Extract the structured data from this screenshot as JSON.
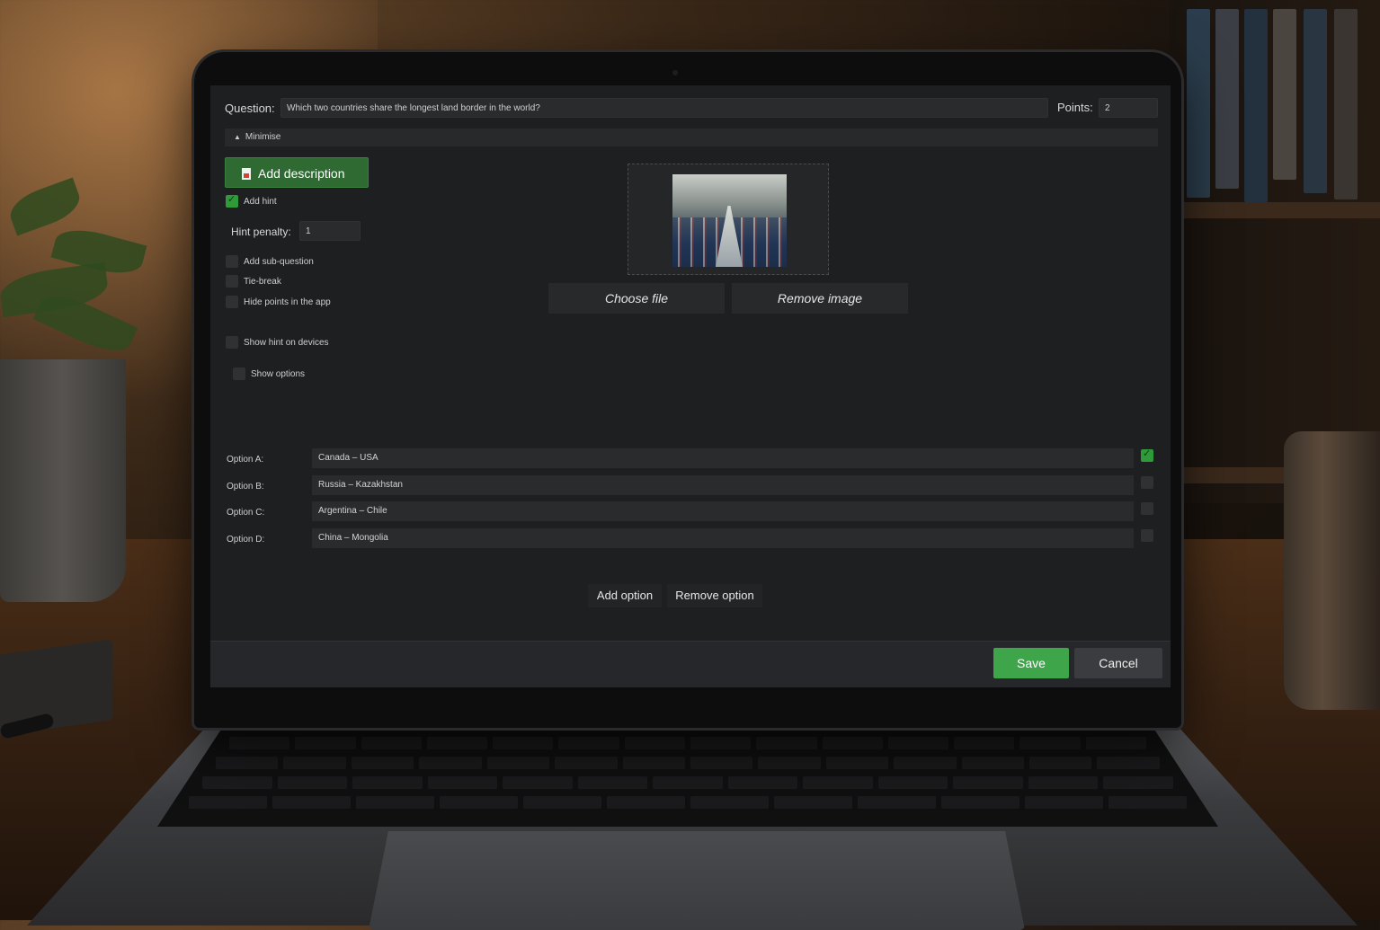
{
  "question": {
    "label": "Question:",
    "value": "Which two countries share the longest land border in the world?",
    "points_label": "Points:",
    "points_value": "2"
  },
  "minimise": {
    "label": "Minimise",
    "icon": "triangle-up-icon"
  },
  "add_description": {
    "label": "Add description",
    "icon": "document-icon"
  },
  "settings": {
    "add_hint": {
      "label": "Add hint",
      "checked": true
    },
    "hint_penalty_label": "Hint penalty:",
    "hint_penalty_value": "1",
    "add_sub_question": {
      "label": "Add sub-question",
      "checked": false
    },
    "tie_break": {
      "label": "Tie-break",
      "checked": false
    },
    "hide_points": {
      "label": "Hide points in the app",
      "checked": false
    },
    "show_hint_devices": {
      "label": "Show hint on devices",
      "checked": false
    },
    "show_options": {
      "label": "Show options",
      "checked": false
    }
  },
  "image": {
    "choose_label": "Choose file",
    "remove_label": "Remove image"
  },
  "options": [
    {
      "label": "Option A:",
      "value": "Canada – USA",
      "correct": true
    },
    {
      "label": "Option B:",
      "value": "Russia – Kazakhstan",
      "correct": false
    },
    {
      "label": "Option C:",
      "value": "Argentina  – Chile",
      "correct": false
    },
    {
      "label": "Option D:",
      "value": "China – Mongolia",
      "correct": false
    }
  ],
  "option_actions": {
    "add_label": "Add option",
    "remove_label": "Remove option"
  },
  "footer": {
    "save_label": "Save",
    "cancel_label": "Cancel"
  },
  "colors": {
    "accent": "#3ea54a",
    "background": "#1e1f20",
    "field": "#2a2b2d"
  }
}
